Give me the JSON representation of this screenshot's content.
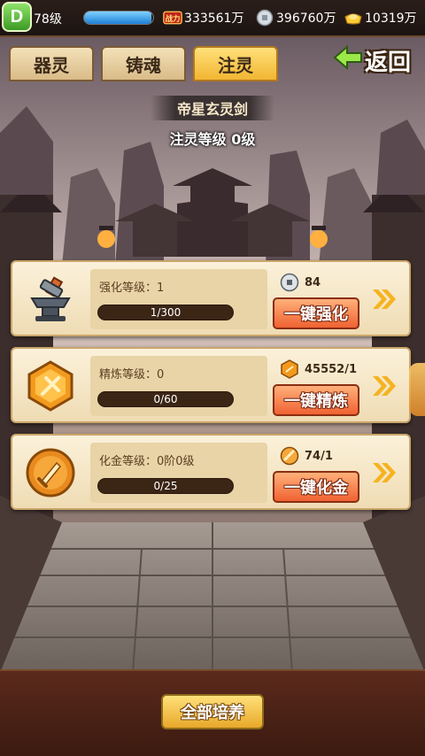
{
  "top_bar": {
    "avatar_letter": "D",
    "level": "78级",
    "exp_progress": 0.97,
    "combat_label": "战力",
    "combat_power": "333561万",
    "silver": "396760万",
    "gold": "10319万"
  },
  "tabs": [
    {
      "label": "器灵",
      "active": false
    },
    {
      "label": "铸魂",
      "active": false
    },
    {
      "label": "注灵",
      "active": true
    }
  ],
  "back_label": "返回",
  "weapon": {
    "name": "帝星玄灵剑",
    "spirit_level": "注灵等级 0级"
  },
  "cards": [
    {
      "icon": "anvil-icon",
      "level_label": "强化等级：1",
      "progress_text": "1/300",
      "progress": 0.0033,
      "cost_icon": "coin-icon",
      "cost": "84",
      "button": "一键强化"
    },
    {
      "icon": "refine-stone-icon",
      "level_label": "精炼等级：0",
      "progress_text": "0/60",
      "progress": 0,
      "cost_icon": "refine-stone-icon",
      "cost": "45552/1",
      "button": "一键精炼"
    },
    {
      "icon": "sword-orb-icon",
      "level_label": "化金等级：0阶0级",
      "progress_text": "0/25",
      "progress": 0,
      "cost_icon": "gold-sword-icon",
      "cost": "74/1",
      "button": "一键化金"
    }
  ],
  "train_all_label": "全部培养",
  "colors": {
    "tab_active": "#f2b632",
    "action_button": "#f06232",
    "card_bg": "#fbf1da"
  }
}
